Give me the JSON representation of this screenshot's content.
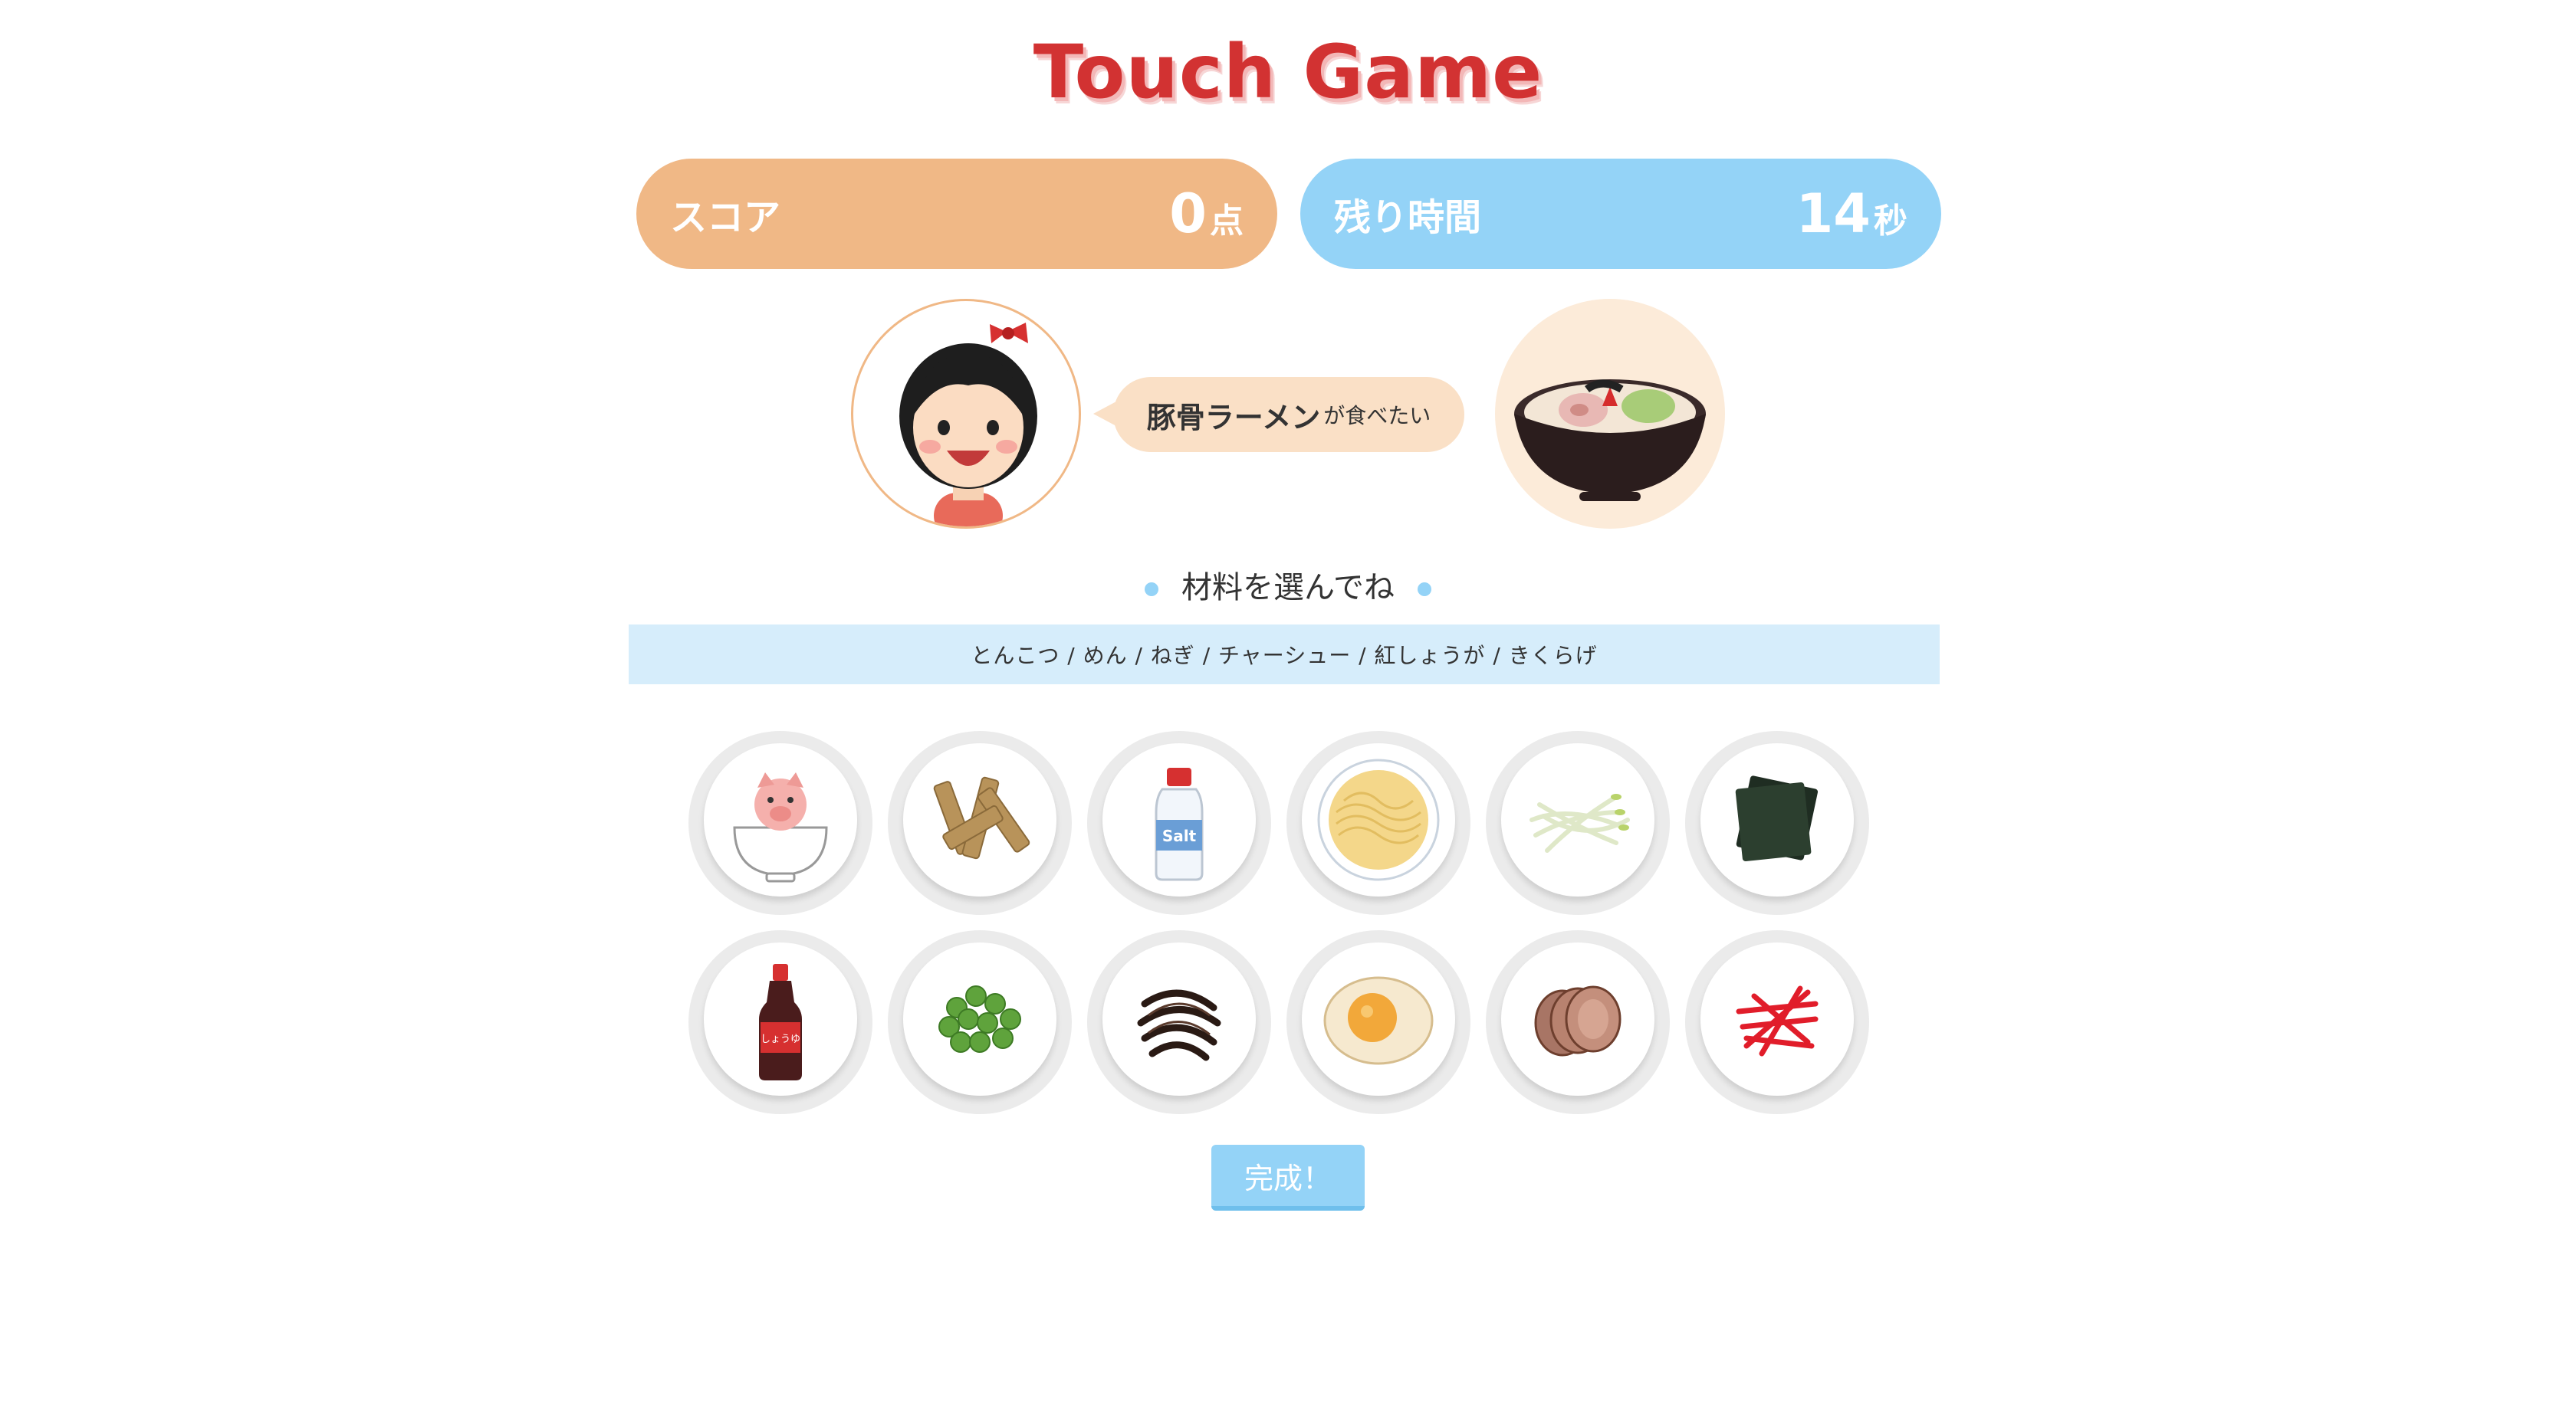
{
  "title": "Touch Game",
  "score": {
    "label": "スコア",
    "value": "0",
    "unit": "点"
  },
  "time": {
    "label": "残り時間",
    "value": "14",
    "unit": "秒"
  },
  "request": {
    "dish": "豚骨ラーメン",
    "suffix": "が食べたい"
  },
  "section_label": "材料を選んでね",
  "ingredients_text": "とんこつ / めん / ねぎ / チャーシュー / 紅しょうが / きくらげ",
  "items": [
    {
      "name": "pork-bone-bowl-icon"
    },
    {
      "name": "menma-icon"
    },
    {
      "name": "salt-bottle-icon",
      "label": "Salt"
    },
    {
      "name": "noodles-icon"
    },
    {
      "name": "bean-sprouts-icon"
    },
    {
      "name": "nori-icon"
    },
    {
      "name": "soy-sauce-bottle-icon",
      "label": "しょうゆ"
    },
    {
      "name": "green-onion-icon"
    },
    {
      "name": "kikurage-icon"
    },
    {
      "name": "boiled-egg-icon"
    },
    {
      "name": "chashu-icon"
    },
    {
      "name": "red-ginger-icon"
    }
  ],
  "done_button": "完成！",
  "colors": {
    "title": "#d23232",
    "score_bg": "#f0b886",
    "time_bg": "#94d3f7",
    "bar_bg": "#d6edfb"
  }
}
